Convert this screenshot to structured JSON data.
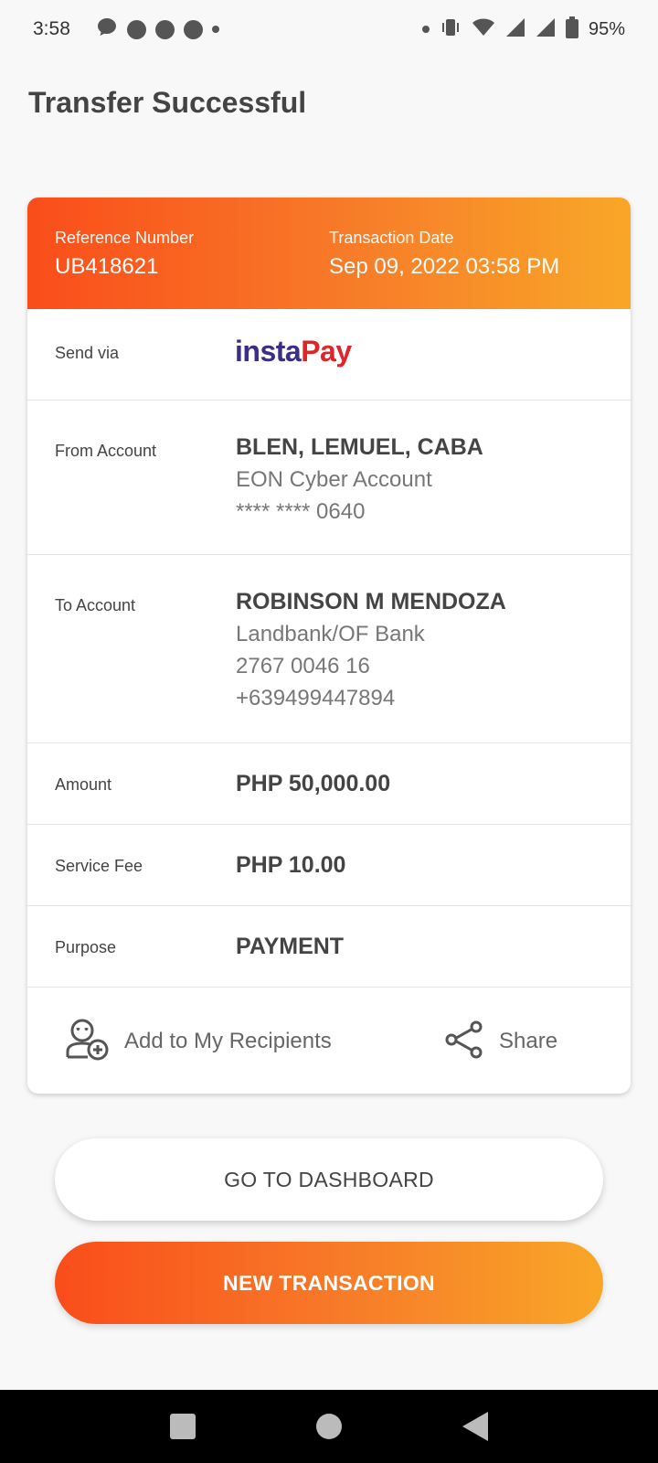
{
  "status_bar": {
    "time": "3:58",
    "battery": "95%"
  },
  "page": {
    "title": "Transfer Successful"
  },
  "receipt": {
    "reference_label": "Reference Number",
    "reference_value": "UB418621",
    "date_label": "Transaction Date",
    "date_value": "Sep 09, 2022 03:58 PM",
    "send_via_label": "Send via",
    "send_via_logo": {
      "part1": "insta",
      "part2": "Pay"
    },
    "from_label": "From Account",
    "from_name": "BLEN, LEMUEL, CABA",
    "from_account_type": "EON Cyber Account",
    "from_account_number": "**** **** 0640",
    "to_label": "To Account",
    "to_name": "ROBINSON M MENDOZA",
    "to_bank": "Landbank/OF Bank",
    "to_account_number": "2767 0046 16",
    "to_phone": "+639499447894",
    "amount_label": "Amount",
    "amount_value": "PHP 50,000.00",
    "fee_label": "Service Fee",
    "fee_value": "PHP 10.00",
    "purpose_label": "Purpose",
    "purpose_value": "PAYMENT"
  },
  "actions": {
    "add_recipient_label": "Add to My Recipients",
    "add_recipient_icon": "add-user-icon",
    "share_label": "Share",
    "share_icon": "share-icon"
  },
  "buttons": {
    "dashboard_label": "GO TO DASHBOARD",
    "new_transaction_label": "NEW TRANSACTION"
  },
  "colors": {
    "gradient_start": "#fa4d1a",
    "gradient_end": "#f9a728",
    "instapay_blue": "#3a2e86",
    "instapay_red": "#e0242a"
  }
}
